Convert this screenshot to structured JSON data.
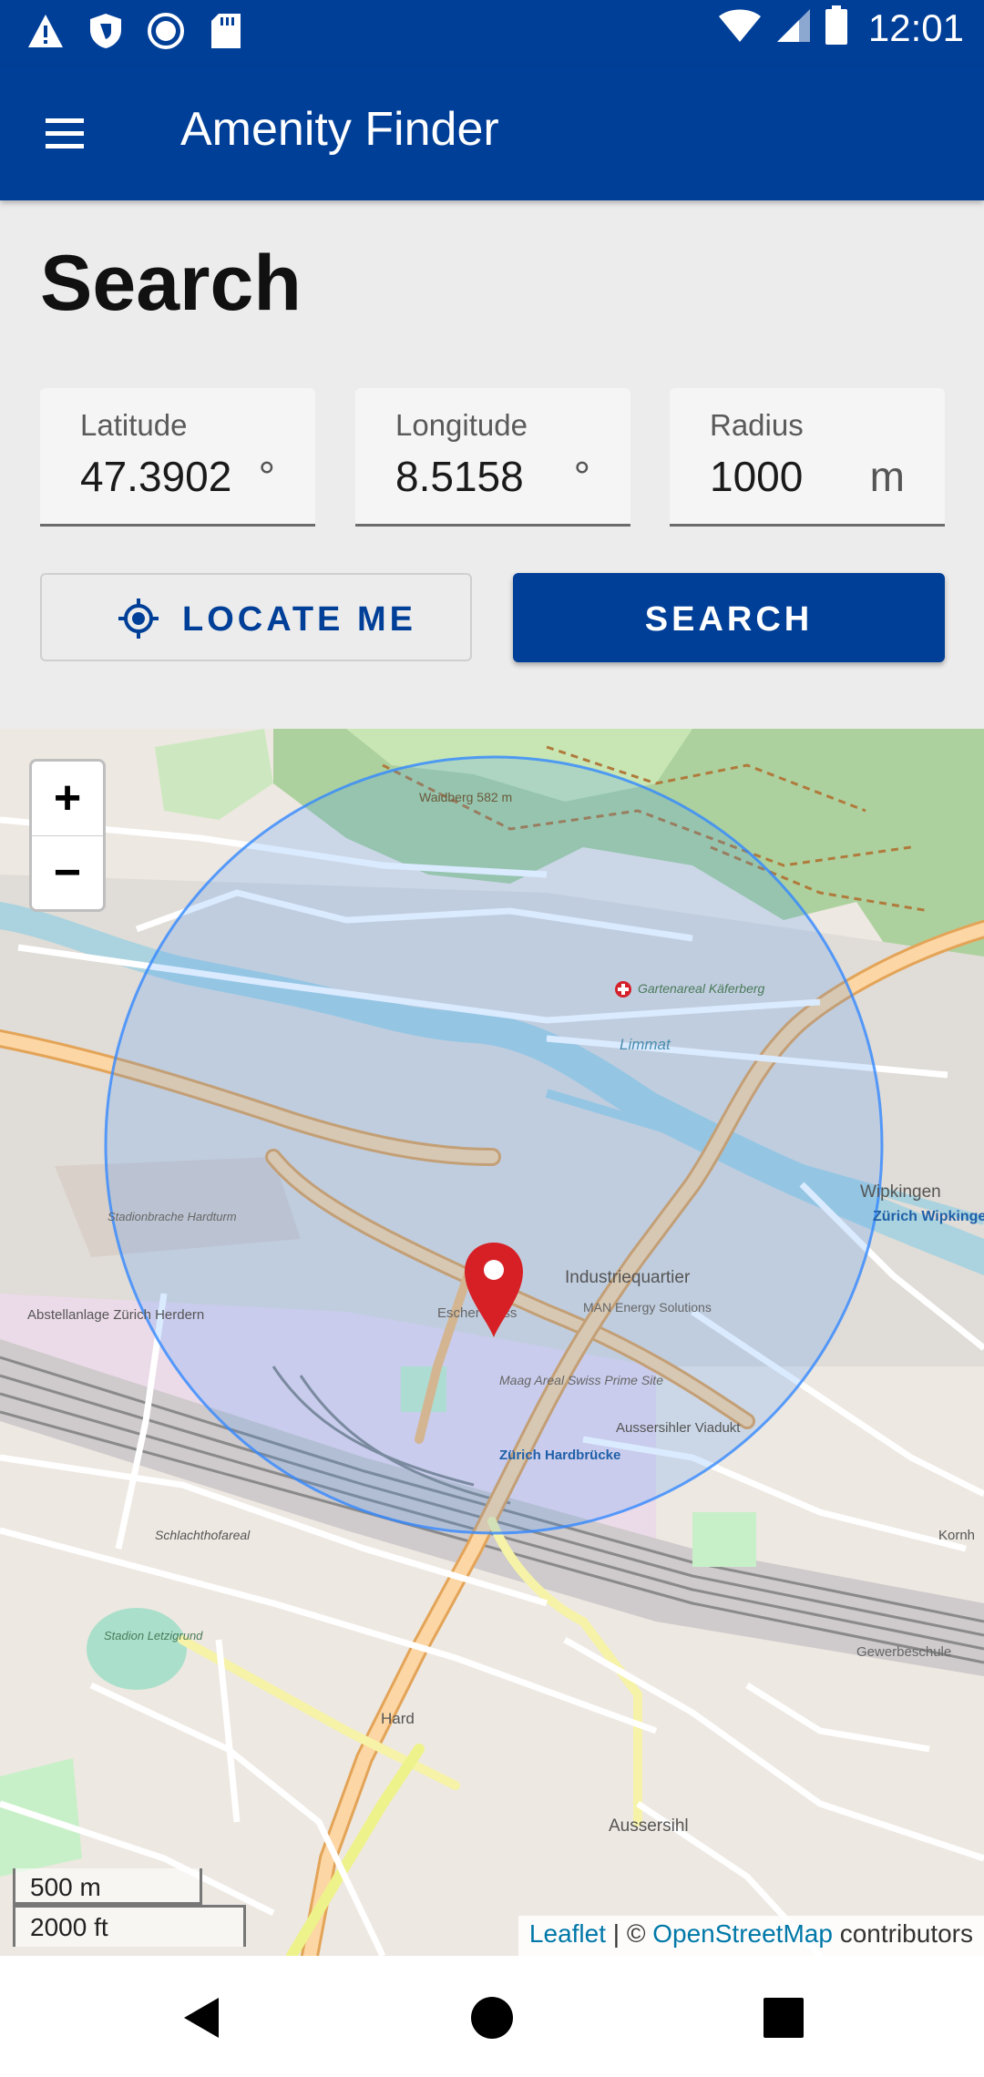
{
  "status_bar": {
    "time": "12:01",
    "icons": [
      "warning-icon",
      "shield-icon",
      "record-icon",
      "sd-card-icon",
      "wifi-icon",
      "signal-icon",
      "battery-icon"
    ]
  },
  "app_bar": {
    "title": "Amenity Finder",
    "menu_icon": "hamburger-menu-icon",
    "color": "#003f98"
  },
  "search": {
    "heading": "Search",
    "latitude": {
      "label": "Latitude",
      "value": "47.3902",
      "suffix": "°"
    },
    "longitude": {
      "label": "Longitude",
      "value": "8.5158",
      "suffix": "°"
    },
    "radius": {
      "label": "Radius",
      "value": "1000",
      "suffix": "m"
    },
    "locate_button": {
      "label": "LOCATE ME",
      "icon": "crosshair-location-icon"
    },
    "search_button": {
      "label": "SEARCH"
    }
  },
  "map": {
    "zoom_in": "+",
    "zoom_out": "−",
    "scale_metric": "500 m",
    "scale_imperial": "2000 ft",
    "attribution": {
      "leaflet": "Leaflet",
      "separator": " | © ",
      "osm": "OpenStreetMap",
      "suffix": " contributors"
    },
    "labels": {
      "wipkingen": "Wipkingen",
      "zurich_wipkingen": "Zürich Wipkingen",
      "industriequartier": "Industriequartier",
      "escher_wyss": "Escher Wyss",
      "man_energy": "MAN Energy Solutions",
      "maag_areal": "Maag Areal Swiss Prime Site",
      "aussersihler_viadukt": "Aussersihler Viadukt",
      "zurich_hardbruecke": "Zürich Hardbrücke",
      "stadion_letzigrund": "Stadion Letzigrund",
      "schlachthofareal": "Schlachthofareal",
      "abstellanlage": "Abstellanlage Zürich Herdern",
      "stadionbrache": "Stadionbrache Hardturm",
      "waidberg": "Waidberg 582 m",
      "gartenareal": "Gartenareal Käferberg",
      "aussersihl": "Aussersihl",
      "hard": "Hard",
      "limmat": "Limmat",
      "gewerbeschule": "Gewerbeschule",
      "kornhaus": "Kornh"
    },
    "marker_color": "#d62026",
    "radius_color": "#3388ff"
  },
  "nav_bar": {
    "back_icon": "back-triangle-icon",
    "home_icon": "home-circle-icon",
    "recents_icon": "recents-square-icon"
  }
}
